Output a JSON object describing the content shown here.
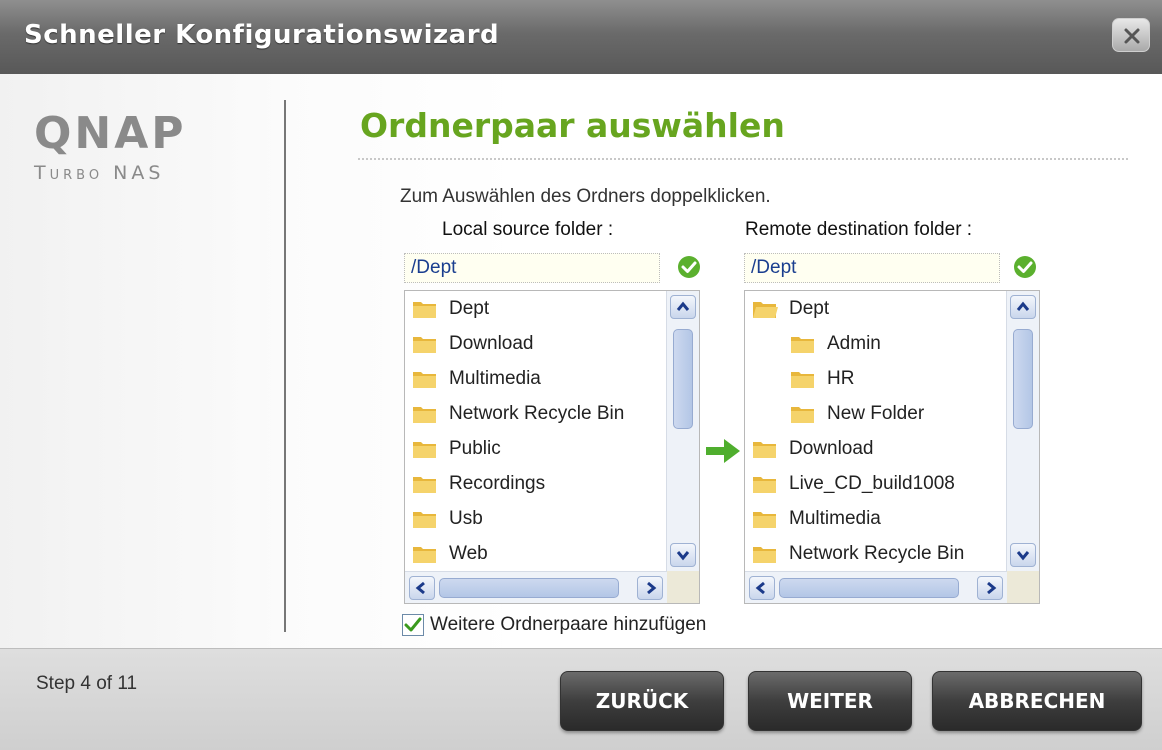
{
  "window": {
    "title": "Schneller Konfigurationswizard"
  },
  "brand": {
    "logo": "QNAP",
    "subtitle": "Turbo NAS"
  },
  "content": {
    "heading": "Ordnerpaar auswählen",
    "instruction": "Zum Auswählen des Ordners doppelklicken.",
    "local": {
      "label": "Local source folder :",
      "path": "/Dept",
      "items": [
        {
          "name": "Dept",
          "indent": 0,
          "open": false
        },
        {
          "name": "Download",
          "indent": 0,
          "open": false
        },
        {
          "name": "Multimedia",
          "indent": 0,
          "open": false
        },
        {
          "name": "Network Recycle Bin",
          "indent": 0,
          "open": false
        },
        {
          "name": "Public",
          "indent": 0,
          "open": false
        },
        {
          "name": "Recordings",
          "indent": 0,
          "open": false
        },
        {
          "name": "Usb",
          "indent": 0,
          "open": false
        },
        {
          "name": "Web",
          "indent": 0,
          "open": false
        }
      ]
    },
    "remote": {
      "label": "Remote destination folder :",
      "path": "/Dept",
      "items": [
        {
          "name": "Dept",
          "indent": 0,
          "open": true
        },
        {
          "name": "Admin",
          "indent": 1,
          "open": false
        },
        {
          "name": "HR",
          "indent": 1,
          "open": false
        },
        {
          "name": "New Folder",
          "indent": 1,
          "open": false
        },
        {
          "name": "Download",
          "indent": 0,
          "open": false
        },
        {
          "name": "Live_CD_build1008",
          "indent": 0,
          "open": false
        },
        {
          "name": "Multimedia",
          "indent": 0,
          "open": false
        },
        {
          "name": "Network Recycle Bin",
          "indent": 0,
          "open": false
        }
      ]
    },
    "add_more": {
      "label": "Weitere Ordnerpaare hinzufügen",
      "checked": true
    }
  },
  "footer": {
    "step": "Step 4 of 11",
    "back": "ZURÜCK",
    "next": "WEITER",
    "cancel": "ABBRECHEN"
  },
  "colors": {
    "accent_green": "#67a51f",
    "path_text": "#1a3e8f",
    "folder_yellow": "#f5d36b"
  },
  "icons": {
    "close": "close-icon",
    "path_ok": "check-circle-icon",
    "folder": "folder-icon",
    "transfer": "arrow-right-icon"
  }
}
